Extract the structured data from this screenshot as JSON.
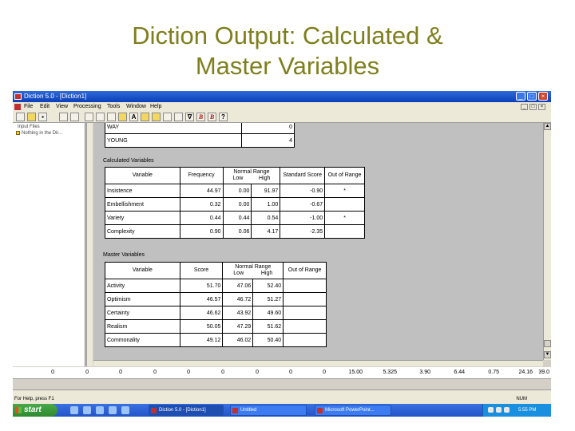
{
  "slide": {
    "title_line1": "Diction Output:  Calculated &",
    "title_line2": "Master Variables"
  },
  "window": {
    "title": "Diction 5.0 - [Diction1]",
    "menu": [
      "File",
      "Edit",
      "View",
      "Processing",
      "Tools",
      "Window",
      "Help"
    ]
  },
  "left_pane": {
    "header": "Input Files",
    "item": "Nothing in the Dir..."
  },
  "top_rows": [
    {
      "variable": "WAY",
      "value": "0"
    },
    {
      "variable": "YOUNG",
      "value": "4"
    }
  ],
  "calculated": {
    "section_label": "Calculated Variables",
    "headers": {
      "variable": "Variable",
      "frequency": "Frequency",
      "normal_range": "Normal Range",
      "low": "Low",
      "high": "High",
      "standard_score": "Standard Score",
      "out_of_range": "Out of Range"
    },
    "rows": [
      {
        "variable": "Insistence",
        "frequency": "44.97",
        "low": "0.00",
        "high": "91.97",
        "score": "-0.90",
        "out": "*"
      },
      {
        "variable": "Embellishment",
        "frequency": "0.32",
        "low": "0.00",
        "high": "1.00",
        "score": "-0.67",
        "out": ""
      },
      {
        "variable": "Variety",
        "frequency": "0.44",
        "low": "0.44",
        "high": "0.54",
        "score": "-1.00",
        "out": "*"
      },
      {
        "variable": "Complexity",
        "frequency": "0.90",
        "low": "0.06",
        "high": "4.17",
        "score": "-2.35",
        "out": ""
      }
    ]
  },
  "master": {
    "section_label": "Master Variables",
    "headers": {
      "variable": "Variable",
      "score": "Score",
      "normal_range": "Normal Range",
      "low": "Low",
      "high": "High",
      "out_of_range": "Out of Range"
    },
    "rows": [
      {
        "variable": "Activity",
        "score": "51.70",
        "low": "47.06",
        "high": "52.40",
        "out": ""
      },
      {
        "variable": "Optimism",
        "score": "46.57",
        "low": "46.72",
        "high": "51.27",
        "out": ""
      },
      {
        "variable": "Certainty",
        "score": "46.62",
        "low": "43.92",
        "high": "49.60",
        "out": ""
      },
      {
        "variable": "Realism",
        "score": "50.05",
        "low": "47.29",
        "high": "51.62",
        "out": ""
      },
      {
        "variable": "Commonality",
        "score": "49.12",
        "low": "46.02",
        "high": "50.40",
        "out": ""
      }
    ]
  },
  "number_strip": [
    "0",
    "0",
    "0",
    "0",
    "0",
    "0",
    "0",
    "0",
    "0",
    "15.00",
    "5.325",
    "3.90",
    "6.44",
    "0.75",
    "24.16",
    "39.0"
  ],
  "status": {
    "left": "For Help, press F1",
    "right": "NUM"
  },
  "taskbar": {
    "start": "start",
    "tasks": [
      "Diction 5.0 - [Diction1]",
      "Untitled",
      "Microsoft PowerPoint..."
    ],
    "clock": "5:55 PM"
  }
}
